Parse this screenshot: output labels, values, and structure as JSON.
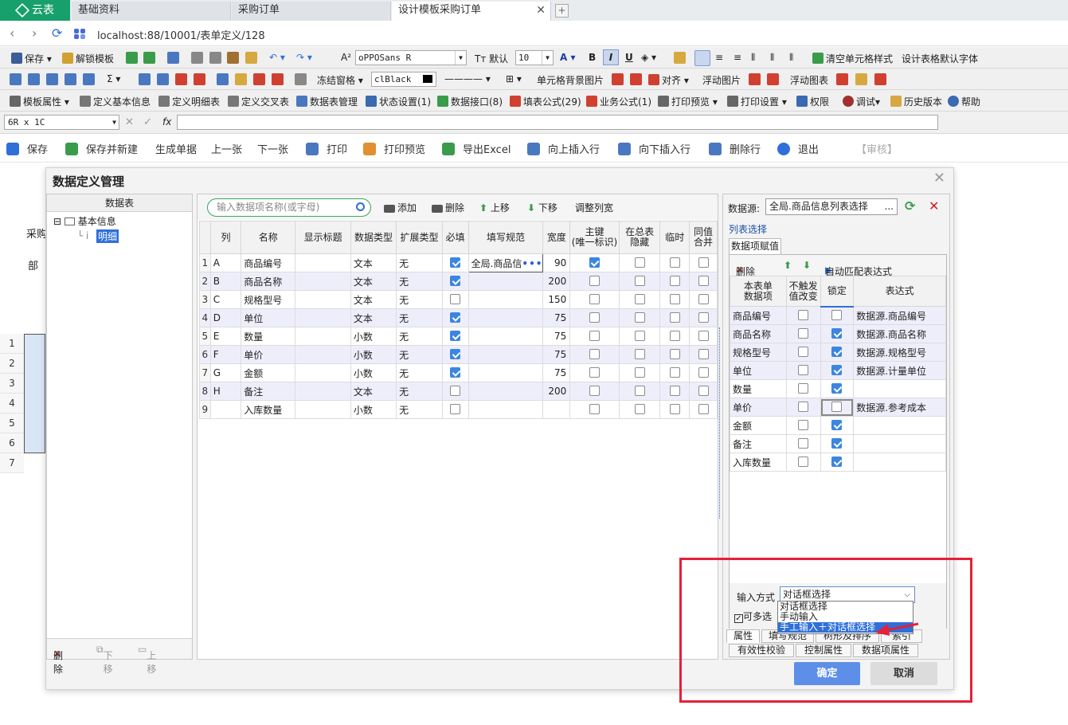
{
  "browser": {
    "home_tab": "云表",
    "tabs": [
      "基础资料",
      "采购订单",
      "设计模板采购订单"
    ],
    "url": "localhost:88/10001/表单定义/128"
  },
  "toolbar1": {
    "save": "保存",
    "unlock": "解锁模板",
    "font_label": "A²",
    "font": "oPPOSans R",
    "default": "默认",
    "size": "10",
    "bold": "B",
    "italic": "I",
    "underline": "U",
    "clear_style": "清空单元格样式",
    "default_font": "设计表格默认字体"
  },
  "toolbar2": {
    "freeze": "冻结窗格",
    "color": "clBlack",
    "bg_image": "单元格背景图片",
    "align": "对齐",
    "float_image": "浮动图片",
    "float_chart": "浮动图表",
    "sum": "Σ"
  },
  "toolbar3": {
    "items": [
      "模板属性",
      "定义基本信息",
      "定义明细表",
      "定义交叉表",
      "数据表管理",
      "状态设置(1)",
      "数据接口(8)",
      "填表公式(29)",
      "业务公式(1)",
      "打印预览",
      "打印设置",
      "权限",
      "调试",
      "历史版本",
      "帮助"
    ]
  },
  "formula_bar": {
    "cell_ref": "6R x 1C",
    "fx": "fx"
  },
  "action_bar": {
    "items": [
      "保存",
      "保存并新建",
      "生成单据",
      "上一张",
      "下一张",
      "打印",
      "打印预览",
      "导出Excel",
      "向上插入行",
      "向下插入行",
      "删除行",
      "退出"
    ],
    "review": "【审核】"
  },
  "background": {
    "labels": [
      "采购",
      "部"
    ],
    "rows": [
      "1",
      "2",
      "3",
      "4",
      "5",
      "6",
      "7"
    ]
  },
  "dialog": {
    "title": "数据定义管理",
    "left": {
      "header": "数据表",
      "root": "基本信息",
      "child": "明细",
      "delete": "删除",
      "down": "下移",
      "up": "上移"
    },
    "middle": {
      "search_placeholder": "输入数据项名称(或字母)",
      "buttons": [
        "添加",
        "删除",
        "上移",
        "下移",
        "调整列宽"
      ],
      "columns": [
        "列",
        "名称",
        "显示标题",
        "数据类型",
        "扩展类型",
        "必填",
        "填写规范",
        "宽度",
        "主键\n(唯一标识)",
        "在总表\n隐藏",
        "临时",
        "同值\n合并"
      ],
      "rows": [
        {
          "idx": "1",
          "col": "A",
          "name": "商品编号",
          "title": "",
          "type": "文本",
          "ext": "无",
          "required": true,
          "rule": "全局.商品信",
          "width": "90",
          "key": true
        },
        {
          "idx": "2",
          "col": "B",
          "name": "商品名称",
          "title": "",
          "type": "文本",
          "ext": "无",
          "required": true,
          "rule": "",
          "width": "200",
          "key": false
        },
        {
          "idx": "3",
          "col": "C",
          "name": "规格型号",
          "title": "",
          "type": "文本",
          "ext": "无",
          "required": false,
          "rule": "",
          "width": "150",
          "key": false
        },
        {
          "idx": "4",
          "col": "D",
          "name": "单位",
          "title": "",
          "type": "文本",
          "ext": "无",
          "required": true,
          "rule": "",
          "width": "75",
          "key": false
        },
        {
          "idx": "5",
          "col": "E",
          "name": "数量",
          "title": "",
          "type": "小数",
          "ext": "无",
          "required": true,
          "rule": "",
          "width": "75",
          "key": false
        },
        {
          "idx": "6",
          "col": "F",
          "name": "单价",
          "title": "",
          "type": "小数",
          "ext": "无",
          "required": true,
          "rule": "",
          "width": "75",
          "key": false
        },
        {
          "idx": "7",
          "col": "G",
          "name": "金额",
          "title": "",
          "type": "小数",
          "ext": "无",
          "required": true,
          "rule": "",
          "width": "75",
          "key": false
        },
        {
          "idx": "8",
          "col": "H",
          "name": "备注",
          "title": "",
          "type": "文本",
          "ext": "无",
          "required": false,
          "rule": "",
          "width": "200",
          "key": false
        },
        {
          "idx": "9",
          "col": "",
          "name": "入库数量",
          "title": "",
          "type": "小数",
          "ext": "无",
          "required": false,
          "rule": "",
          "width": "",
          "key": false
        }
      ],
      "dots": "•••"
    },
    "right": {
      "datasource_label": "数据源:",
      "datasource_value": "全局.商品信息列表选择",
      "datasource_more": "...",
      "list_label": "列表选择",
      "subtab": "数据项赋值",
      "toolbar": {
        "delete": "删除",
        "auto_match": "自动匹配表达式"
      },
      "columns": [
        "本表单\n数据项",
        "不触发\n值改变",
        "锁定",
        "表达式"
      ],
      "rows": [
        {
          "item": "商品编号",
          "no_trigger": false,
          "lock": false,
          "expr": "数据源.商品编号"
        },
        {
          "item": "商品名称",
          "no_trigger": false,
          "lock": true,
          "expr": "数据源.商品名称"
        },
        {
          "item": "规格型号",
          "no_trigger": false,
          "lock": true,
          "expr": "数据源.规格型号"
        },
        {
          "item": "单位",
          "no_trigger": false,
          "lock": true,
          "expr": "数据源.计量单位"
        },
        {
          "item": "数量",
          "no_trigger": false,
          "lock": true,
          "expr": ""
        },
        {
          "item": "单价",
          "no_trigger": false,
          "lock": false,
          "expr": "数据源.参考成本"
        },
        {
          "item": "金额",
          "no_trigger": false,
          "lock": true,
          "expr": ""
        },
        {
          "item": "备注",
          "no_trigger": false,
          "lock": true,
          "expr": ""
        },
        {
          "item": "入库数量",
          "no_trigger": false,
          "lock": true,
          "expr": ""
        }
      ],
      "input_mode_label": "输入方式",
      "input_mode_value": "对话框选择",
      "multi_select": "可多选",
      "dropdown_options": [
        "对话框选择",
        "手动输入",
        "手工输入＋对话框选择"
      ],
      "bottom_tabs_row1": [
        "属性",
        "填写规范",
        "树形及排序",
        "索引"
      ],
      "bottom_tabs_row2": [
        "有效性校验",
        "控制属性",
        "数据项属性"
      ]
    },
    "ok": "确定",
    "cancel": "取消"
  },
  "colors": {
    "accent": "#17a06b",
    "check": "#3b86e0",
    "ok_button": "#5d8fe8",
    "annotation": "#e5203a"
  }
}
